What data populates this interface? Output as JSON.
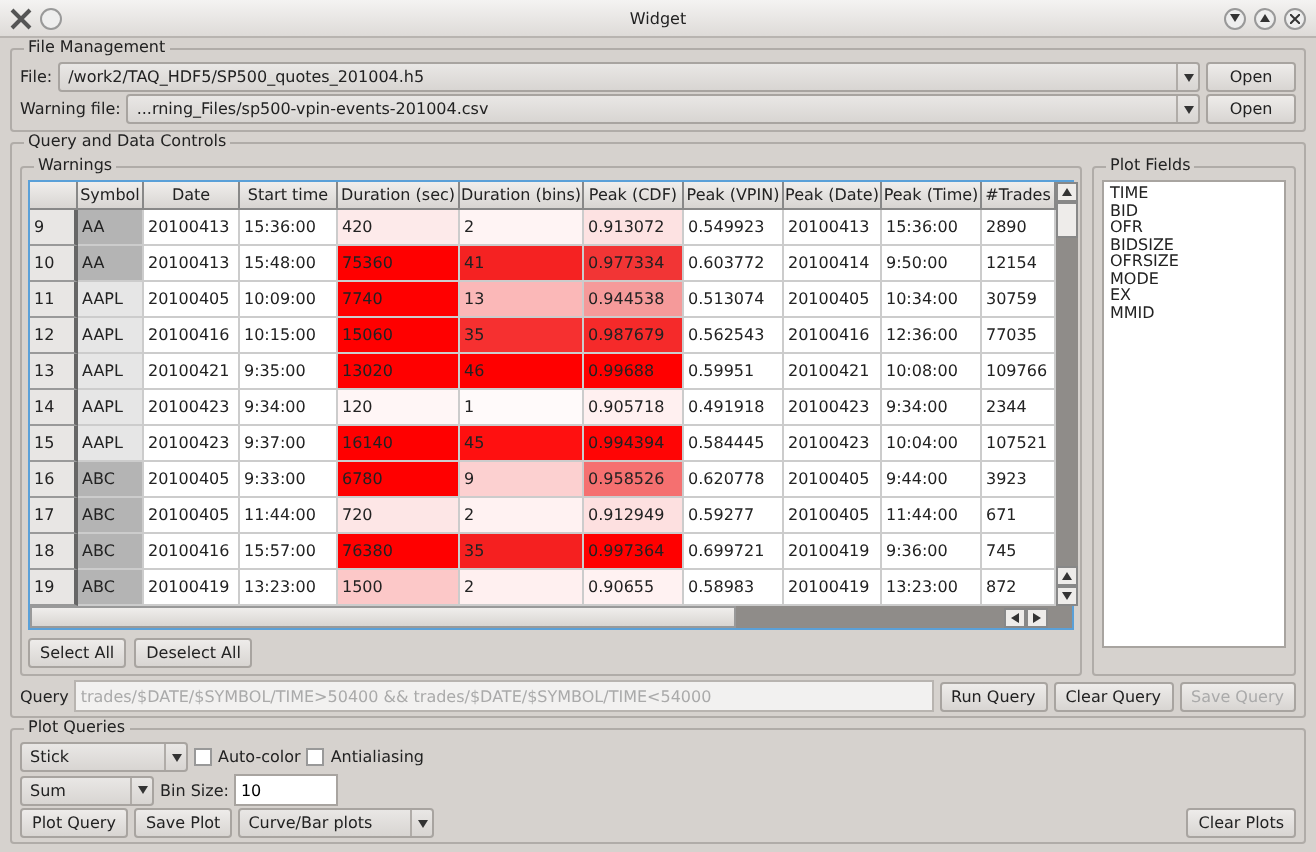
{
  "window": {
    "title": "Widget"
  },
  "file_management": {
    "title": "File Management",
    "file_label": "File:",
    "file_value": "/work2/TAQ_HDF5/SP500_quotes_201004.h5",
    "file_button": "Open",
    "warning_label": "Warning file:",
    "warning_value": "...rning_Files/sp500-vpin-events-201004.csv",
    "warning_button": "Open"
  },
  "query_controls": {
    "title": "Query and Data Controls",
    "warnings": {
      "title": "Warnings",
      "columns": [
        "Symbol",
        "Date",
        "Start time",
        "Duration (sec)",
        "Duration (bins)",
        "Peak (CDF)",
        "Peak (VPIN)",
        "Peak (Date)",
        "Peak (Time)",
        "#Trades"
      ],
      "rows": [
        {
          "header": "9",
          "cells": [
            {
              "text": "AA",
              "color": "#b4b4b4"
            },
            {
              "text": "20100413",
              "color": "#ffffff"
            },
            {
              "text": "15:36:00",
              "color": "#ffffff"
            },
            {
              "text": "420",
              "color": "#fdeaea"
            },
            {
              "text": "2",
              "color": "#fff4f4"
            },
            {
              "text": "0.913072",
              "color": "#fde2e2"
            },
            {
              "text": "0.549923",
              "color": "#ffffff"
            },
            {
              "text": "20100413",
              "color": "#ffffff"
            },
            {
              "text": "15:36:00",
              "color": "#ffffff"
            },
            {
              "text": "2890",
              "color": "#ffffff"
            }
          ]
        },
        {
          "header": "10",
          "cells": [
            {
              "text": "AA",
              "color": "#b4b4b4"
            },
            {
              "text": "20100413",
              "color": "#ffffff"
            },
            {
              "text": "15:48:00",
              "color": "#ffffff"
            },
            {
              "text": "75360",
              "color": "#ff0000"
            },
            {
              "text": "41",
              "color": "#f52222"
            },
            {
              "text": "0.977334",
              "color": "#f23535"
            },
            {
              "text": "0.603772",
              "color": "#ffffff"
            },
            {
              "text": "20100414",
              "color": "#ffffff"
            },
            {
              "text": "9:50:00",
              "color": "#ffffff"
            },
            {
              "text": "12154",
              "color": "#ffffff"
            }
          ]
        },
        {
          "header": "11",
          "cells": [
            {
              "text": "AAPL",
              "color": "#e6e6e6"
            },
            {
              "text": "20100405",
              "color": "#ffffff"
            },
            {
              "text": "10:09:00",
              "color": "#ffffff"
            },
            {
              "text": "7740",
              "color": "#ff0000"
            },
            {
              "text": "13",
              "color": "#fbb8b8"
            },
            {
              "text": "0.944538",
              "color": "#f59a9a"
            },
            {
              "text": "0.513074",
              "color": "#ffffff"
            },
            {
              "text": "20100405",
              "color": "#ffffff"
            },
            {
              "text": "10:34:00",
              "color": "#ffffff"
            },
            {
              "text": "30759",
              "color": "#ffffff"
            }
          ]
        },
        {
          "header": "12",
          "cells": [
            {
              "text": "AAPL",
              "color": "#e6e6e6"
            },
            {
              "text": "20100416",
              "color": "#ffffff"
            },
            {
              "text": "10:15:00",
              "color": "#ffffff"
            },
            {
              "text": "15060",
              "color": "#ff0000"
            },
            {
              "text": "35",
              "color": "#f63030"
            },
            {
              "text": "0.987679",
              "color": "#f52a2a"
            },
            {
              "text": "0.562543",
              "color": "#ffffff"
            },
            {
              "text": "20100416",
              "color": "#ffffff"
            },
            {
              "text": "12:36:00",
              "color": "#ffffff"
            },
            {
              "text": "77035",
              "color": "#ffffff"
            }
          ]
        },
        {
          "header": "13",
          "cells": [
            {
              "text": "AAPL",
              "color": "#e6e6e6"
            },
            {
              "text": "20100421",
              "color": "#ffffff"
            },
            {
              "text": "9:35:00",
              "color": "#ffffff"
            },
            {
              "text": "13020",
              "color": "#ff0000"
            },
            {
              "text": "46",
              "color": "#ff0000"
            },
            {
              "text": "0.99688",
              "color": "#ff0000"
            },
            {
              "text": "0.59951",
              "color": "#ffffff"
            },
            {
              "text": "20100421",
              "color": "#ffffff"
            },
            {
              "text": "10:08:00",
              "color": "#ffffff"
            },
            {
              "text": "109766",
              "color": "#ffffff"
            }
          ]
        },
        {
          "header": "14",
          "cells": [
            {
              "text": "AAPL",
              "color": "#e6e6e6"
            },
            {
              "text": "20100423",
              "color": "#ffffff"
            },
            {
              "text": "9:34:00",
              "color": "#ffffff"
            },
            {
              "text": "120",
              "color": "#fff6f6"
            },
            {
              "text": "1",
              "color": "#fffafa"
            },
            {
              "text": "0.905718",
              "color": "#fff0f0"
            },
            {
              "text": "0.491918",
              "color": "#ffffff"
            },
            {
              "text": "20100423",
              "color": "#ffffff"
            },
            {
              "text": "9:34:00",
              "color": "#ffffff"
            },
            {
              "text": "2344",
              "color": "#ffffff"
            }
          ]
        },
        {
          "header": "15",
          "cells": [
            {
              "text": "AAPL",
              "color": "#e6e6e6"
            },
            {
              "text": "20100423",
              "color": "#ffffff"
            },
            {
              "text": "9:37:00",
              "color": "#ffffff"
            },
            {
              "text": "16140",
              "color": "#ff0000"
            },
            {
              "text": "45",
              "color": "#ff1010"
            },
            {
              "text": "0.994394",
              "color": "#ff0505"
            },
            {
              "text": "0.584445",
              "color": "#ffffff"
            },
            {
              "text": "20100423",
              "color": "#ffffff"
            },
            {
              "text": "10:04:00",
              "color": "#ffffff"
            },
            {
              "text": "107521",
              "color": "#ffffff"
            }
          ]
        },
        {
          "header": "16",
          "cells": [
            {
              "text": "ABC",
              "color": "#b4b4b4"
            },
            {
              "text": "20100405",
              "color": "#ffffff"
            },
            {
              "text": "9:33:00",
              "color": "#ffffff"
            },
            {
              "text": "6780",
              "color": "#ff0000"
            },
            {
              "text": "9",
              "color": "#fcd0d0"
            },
            {
              "text": "0.958526",
              "color": "#f57070"
            },
            {
              "text": "0.620778",
              "color": "#ffffff"
            },
            {
              "text": "20100405",
              "color": "#ffffff"
            },
            {
              "text": "9:44:00",
              "color": "#ffffff"
            },
            {
              "text": "3923",
              "color": "#ffffff"
            }
          ]
        },
        {
          "header": "17",
          "cells": [
            {
              "text": "ABC",
              "color": "#b4b4b4"
            },
            {
              "text": "20100405",
              "color": "#ffffff"
            },
            {
              "text": "11:44:00",
              "color": "#ffffff"
            },
            {
              "text": "720",
              "color": "#fde6e6"
            },
            {
              "text": "2",
              "color": "#fff2f2"
            },
            {
              "text": "0.912949",
              "color": "#fde0e0"
            },
            {
              "text": "0.59277",
              "color": "#ffffff"
            },
            {
              "text": "20100405",
              "color": "#ffffff"
            },
            {
              "text": "11:44:00",
              "color": "#ffffff"
            },
            {
              "text": "671",
              "color": "#ffffff"
            }
          ]
        },
        {
          "header": "18",
          "cells": [
            {
              "text": "ABC",
              "color": "#b4b4b4"
            },
            {
              "text": "20100416",
              "color": "#ffffff"
            },
            {
              "text": "15:57:00",
              "color": "#ffffff"
            },
            {
              "text": "76380",
              "color": "#ff0000"
            },
            {
              "text": "35",
              "color": "#f52020"
            },
            {
              "text": "0.997364",
              "color": "#ff0000"
            },
            {
              "text": "0.699721",
              "color": "#ffffff"
            },
            {
              "text": "20100419",
              "color": "#ffffff"
            },
            {
              "text": "9:36:00",
              "color": "#ffffff"
            },
            {
              "text": "745",
              "color": "#ffffff"
            }
          ]
        },
        {
          "header": "19",
          "cells": [
            {
              "text": "ABC",
              "color": "#b4b4b4"
            },
            {
              "text": "20100419",
              "color": "#ffffff"
            },
            {
              "text": "13:23:00",
              "color": "#ffffff"
            },
            {
              "text": "1500",
              "color": "#fcc8c8"
            },
            {
              "text": "2",
              "color": "#fff0f0"
            },
            {
              "text": "0.90655",
              "color": "#fff2f2"
            },
            {
              "text": "0.58983",
              "color": "#ffffff"
            },
            {
              "text": "20100419",
              "color": "#ffffff"
            },
            {
              "text": "13:23:00",
              "color": "#ffffff"
            },
            {
              "text": "872",
              "color": "#ffffff"
            }
          ]
        }
      ],
      "buttons": [
        "Select All",
        "Deselect All"
      ]
    },
    "plot_fields": {
      "title": "Plot Fields",
      "items": [
        "TIME",
        "BID",
        "OFR",
        "BIDSIZE",
        "OFRSIZE",
        "MODE",
        "EX",
        "MMID"
      ]
    },
    "query_label": "Query",
    "query_placeholder": "trades/$DATE/$SYMBOL/TIME>50400 && trades/$DATE/$SYMBOL/TIME<54000",
    "buttons": [
      {
        "label": "Run Query",
        "disabled": false
      },
      {
        "label": "Clear Query",
        "disabled": false
      },
      {
        "label": "Save Query",
        "disabled": true
      }
    ]
  },
  "plot_queries": {
    "title": "Plot Queries",
    "style": "Stick",
    "auto_color": {
      "label": "Auto-color",
      "checked": false
    },
    "antialiasing": {
      "label": "Antialiasing",
      "checked": false
    },
    "aggregate": "Sum",
    "bin_size_label": "Bin Size:",
    "bin_size": "10",
    "plot_query": "Plot Query",
    "save_plot": "Save Plot",
    "plot_type": "Curve/Bar plots",
    "clear_plots": "Clear Plots"
  }
}
